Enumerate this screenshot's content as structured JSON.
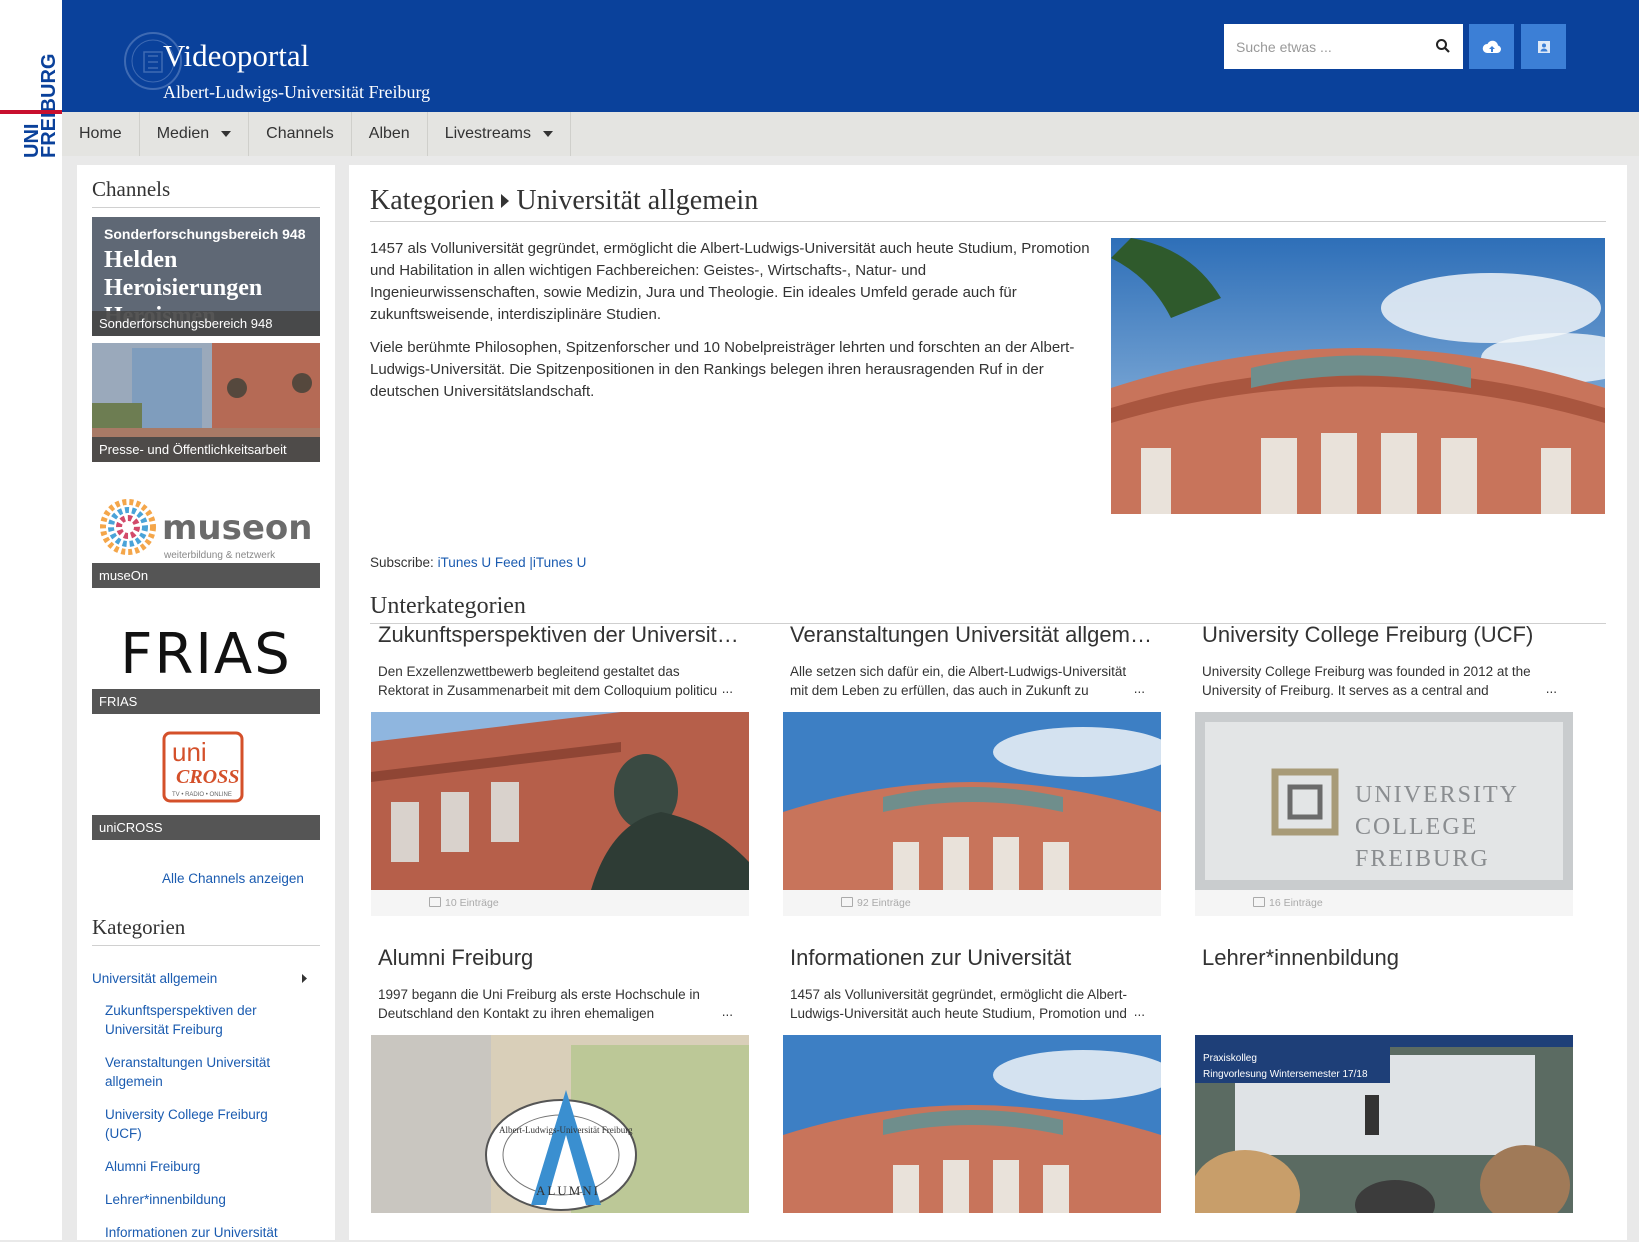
{
  "brand": {
    "logo_text_uni": "UNI",
    "logo_text_freiburg": "FREIBURG",
    "site_title": "Videoportal",
    "site_subtitle": "Albert-Ludwigs-Universität Freiburg"
  },
  "search": {
    "placeholder": "Suche etwas ..."
  },
  "nav": {
    "items": [
      {
        "label": "Home",
        "dropdown": false
      },
      {
        "label": "Medien",
        "dropdown": true
      },
      {
        "label": "Channels",
        "dropdown": false
      },
      {
        "label": "Alben",
        "dropdown": false
      },
      {
        "label": "Livestreams",
        "dropdown": true
      }
    ]
  },
  "sidebar": {
    "channels_heading": "Channels",
    "channels": [
      {
        "label": "Sonderforschungsbereich 948",
        "image_text": [
          "Sonderforschungsbereich 948",
          "Helden",
          "Heroisierungen",
          "Heroismen"
        ]
      },
      {
        "label": "Presse- und Öffentlichkeitsarbeit"
      },
      {
        "label": "museOn",
        "logo_text": "museon",
        "logo_subtext": "weiterbildung & netzwerk"
      },
      {
        "label": "FRIAS",
        "logo_text": "FRIAS"
      },
      {
        "label": "uniCROSS",
        "logo_text_1": "uni",
        "logo_text_2": "CROSS",
        "logo_subtext": "TV • RADIO • ONLINE"
      }
    ],
    "all_channels_link": "Alle Channels anzeigen",
    "categories_heading": "Kategorien",
    "categories": [
      {
        "label": "Universität allgemein",
        "level": 0
      },
      {
        "label": "Zukunftsperspektiven der Universität Freiburg",
        "level": 1
      },
      {
        "label": "Veranstaltungen Universität allgemein",
        "level": 1
      },
      {
        "label": "University College Freiburg (UCF)",
        "level": 1
      },
      {
        "label": "Alumni Freiburg",
        "level": 1
      },
      {
        "label": "Lehrer*innenbildung",
        "level": 1
      },
      {
        "label": "Informationen zur Universität",
        "level": 1
      }
    ]
  },
  "main": {
    "breadcrumb_root": "Kategorien",
    "breadcrumb_current": "Universität allgemein",
    "paragraph_1": "1457 als Volluniversität gegründet, ermöglicht die Albert-Ludwigs-Universität auch heute Studium, Promotion und Habilitation in allen wichtigen Fachbereichen: Geistes-, Wirtschafts-, Natur- und Ingenieurwissenschaften, sowie Medizin, Jura und Theologie. Ein ideales Umfeld gerade auch für zukunftsweisende, interdisziplinäre Studien.",
    "paragraph_2": "Viele berühmte Philosophen, Spitzenforscher und 10 Nobelpreisträger lehrten und forschten an der Albert-Ludwigs-Universität. Die Spitzenpositionen in den Rankings belegen ihren herausragenden Ruf in der deutschen Universitätslandschaft.",
    "subscribe_label": "Subscribe:",
    "subscribe_link_1": "iTunes U Feed",
    "subscribe_link_2": "|iTunes U",
    "subcategories_heading": "Unterkategorien",
    "subcategories": [
      {
        "title": "Zukunftsperspektiven der Universität Freiburg",
        "desc": "Den Exzellenzwettbewerb begleitend gestaltet das Rektorat in Zusammenarbeit mit dem Colloquium politicum",
        "more": "...",
        "count": "10 Einträge"
      },
      {
        "title": "Veranstaltungen Universität allgemein",
        "desc": "Alle setzen sich dafür ein, die Albert-Ludwigs-Universität mit dem Leben zu erfüllen, das auch in Zukunft zu",
        "more": "...",
        "count": "92 Einträge"
      },
      {
        "title": "University College Freiburg (UCF)",
        "desc": "University College Freiburg was founded in 2012 at the University of Freiburg. It serves as a central and",
        "more": "...",
        "count": "16 Einträge",
        "image_text": [
          "UNIVERSITY",
          "COLLEGE",
          "FREIBURG"
        ]
      },
      {
        "title": "Alumni Freiburg",
        "desc": "1997 begann die Uni Freiburg als erste Hochschule in Deutschland den Kontakt zu ihren ehemaligen",
        "more": "...",
        "image_text": [
          "Albert-Ludwigs-Universität Freiburg",
          "ALUMNI"
        ]
      },
      {
        "title": "Informationen zur Universität",
        "desc": "1457 als Volluniversität gegründet, ermöglicht die Albert-Ludwigs-Universität auch heute Studium, Promotion und",
        "more": "..."
      },
      {
        "title": "Lehrer*innenbildung",
        "desc": "",
        "more": "",
        "image_text": [
          "Praxiskolleg",
          "Ringvorlesung Wintersemester 17/18"
        ]
      }
    ]
  },
  "colors": {
    "header_blue": "#0a419b",
    "accent_red": "#c8102e",
    "link_blue": "#1a5bb0",
    "nav_bg": "#e4e4e1"
  },
  "icons": {
    "search": "search-icon",
    "upload": "cloud-upload-icon",
    "user": "user-icon",
    "folder": "folder-icon",
    "caret": "caret-down-icon",
    "arrow": "caret-right-icon"
  }
}
